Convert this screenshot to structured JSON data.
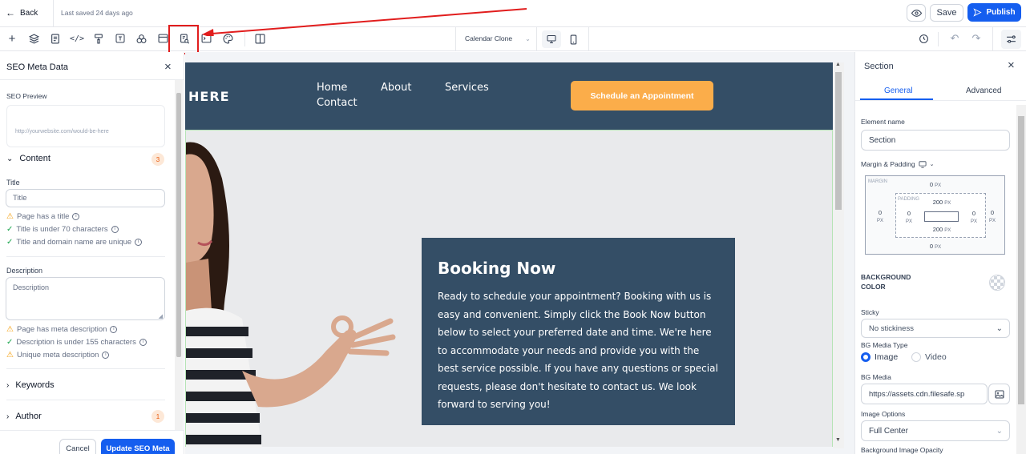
{
  "topbar": {
    "back_label": "Back",
    "saved_status": "Last saved 24 days ago",
    "save_label": "Save",
    "publish_label": "Publish"
  },
  "toolbar": {
    "page_selector": "Calendar Clone",
    "icons": [
      "plus-icon",
      "layers-icon",
      "pages-icon",
      "code-icon",
      "paint-roller-icon",
      "text-icon",
      "elements-icon",
      "layout-icon",
      "seo-meta-icon",
      "terminal-icon",
      "palette-icon",
      "columns-icon"
    ],
    "highlight_color": "#e11d1d"
  },
  "left_panel": {
    "title": "SEO Meta Data",
    "seo_preview_label": "SEO Preview",
    "preview_url": "http://yourwebsite.com/would-be-here",
    "content_section": {
      "label": "Content",
      "count": "3"
    },
    "title_label": "Title",
    "title_placeholder": "Title",
    "title_checks": [
      {
        "status": "warn",
        "text": "Page has a title"
      },
      {
        "status": "ok",
        "text": "Title is under 70 characters"
      },
      {
        "status": "ok",
        "text": "Title and domain name are unique"
      }
    ],
    "description_label": "Description",
    "description_placeholder": "Description",
    "description_checks": [
      {
        "status": "warn",
        "text": "Page has meta description"
      },
      {
        "status": "ok",
        "text": "Description is under 155 characters"
      },
      {
        "status": "warn",
        "text": "Unique meta description"
      }
    ],
    "keywords_label": "Keywords",
    "author_label": "Author",
    "author_count": "1",
    "cancel_label": "Cancel",
    "update_label": "Update SEO Meta"
  },
  "canvas": {
    "logo_text": "HERE",
    "nav": [
      "Home",
      "About",
      "Services",
      "Contact"
    ],
    "cta_label": "Schedule an Appointment",
    "booking_title": "Booking Now",
    "booking_text": "Ready to schedule your appointment? Booking with us is easy and convenient. Simply click the Book Now button below to select your preferred date and time. We're here to accommodate your needs and provide you with the best service possible. If you have any questions or special requests, please don't hesitate to contact us. We look forward to serving you!",
    "header_color": "#344e66",
    "cta_color": "#fbad4a"
  },
  "right_panel": {
    "title": "Section",
    "tabs": [
      "General",
      "Advanced"
    ],
    "element_name_label": "Element name",
    "element_name_value": "Section",
    "margin_padding_label": "Margin & Padding",
    "margin_label": "MARGIN",
    "padding_label": "PADDING",
    "margin": {
      "top": "0",
      "right": "0",
      "bottom": "0",
      "left": "0"
    },
    "padding": {
      "top": "200",
      "right": "0",
      "bottom": "200",
      "left": "0"
    },
    "unit": "PX",
    "bg_color_label": "BACKGROUND COLOR",
    "sticky_label": "Sticky",
    "sticky_value": "No stickiness",
    "bg_media_type_label": "BG Media Type",
    "media_types": [
      "Image",
      "Video"
    ],
    "bg_media_label": "BG Media",
    "bg_media_value": "https://assets.cdn.filesafe.sp",
    "image_options_label": "Image Options",
    "image_options_value": "Full Center",
    "bg_opacity_label": "Background Image Opacity"
  },
  "colors": {
    "primary": "#155eef",
    "warn": "#f59e0b",
    "ok": "#16a34a"
  }
}
